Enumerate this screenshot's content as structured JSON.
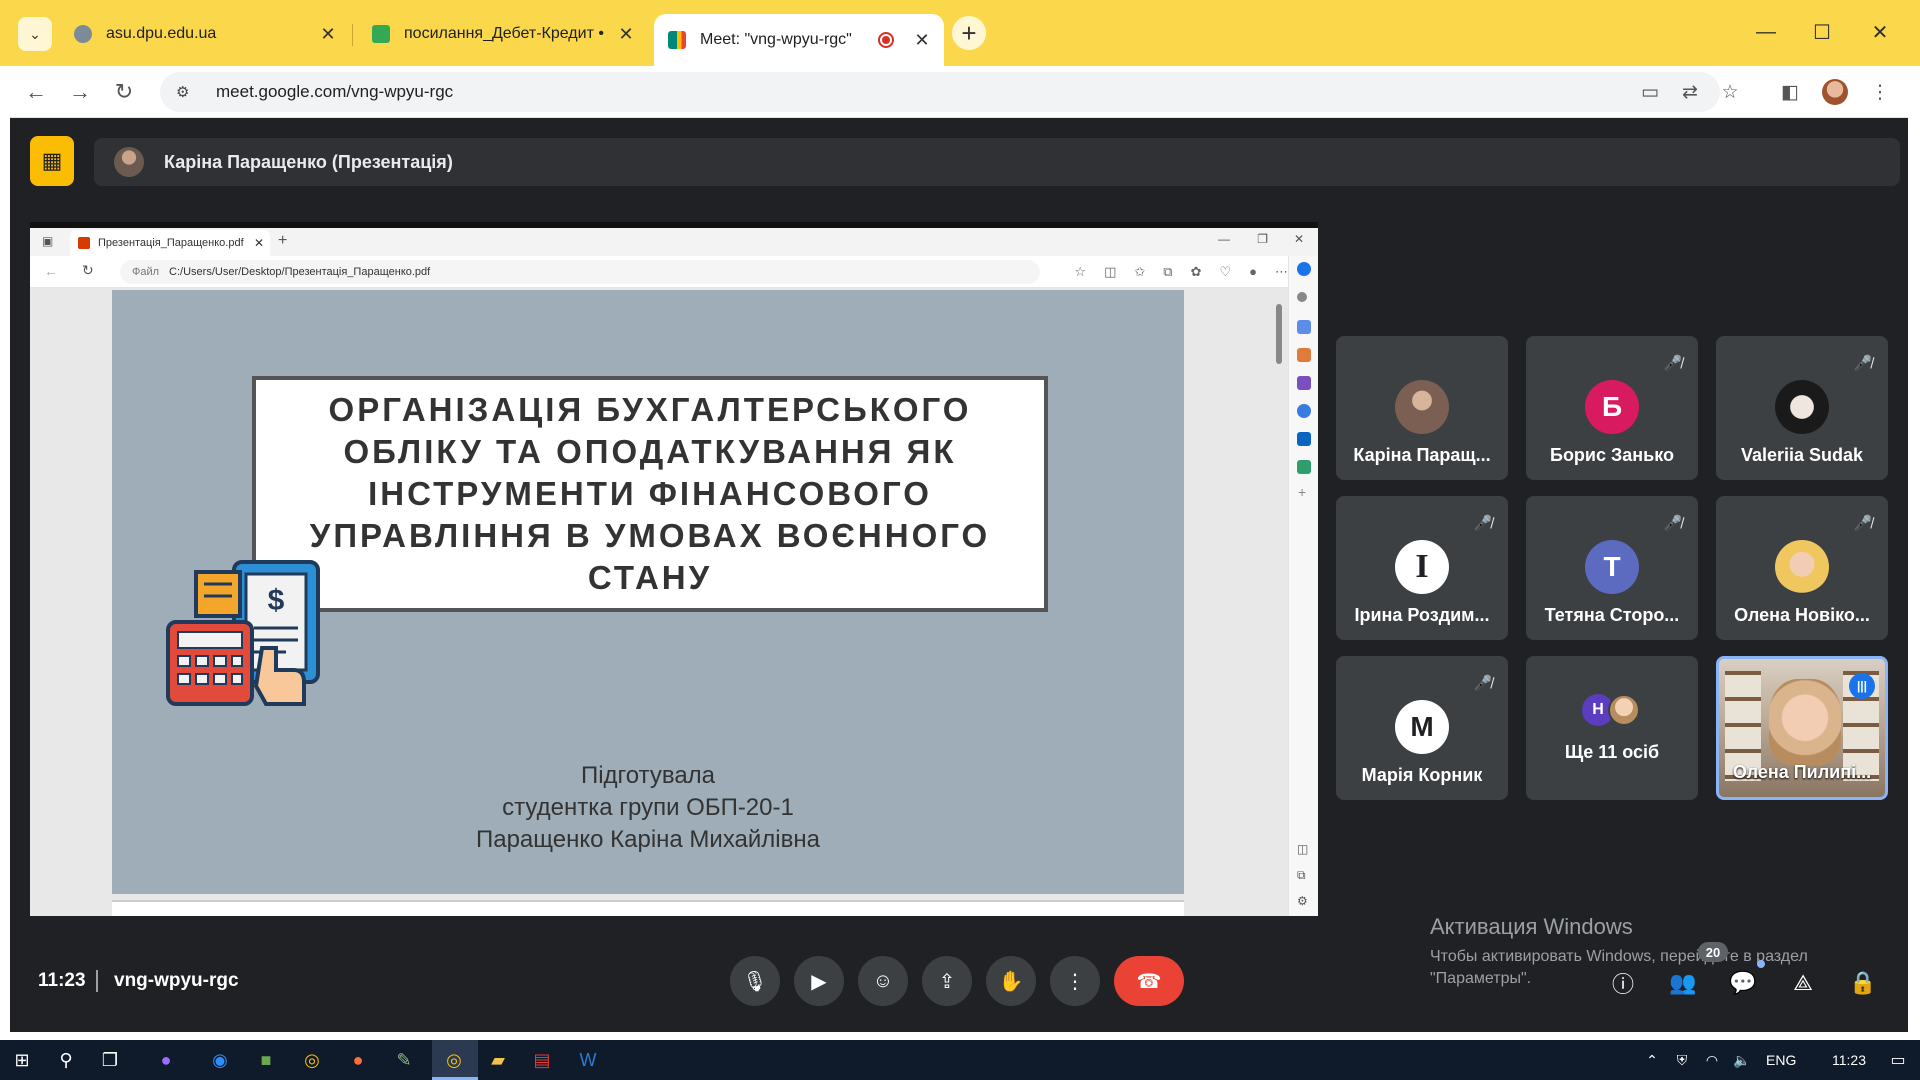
{
  "browser": {
    "tabs": [
      {
        "title": "asu.dpu.edu.ua",
        "favicon_color": "#7d8b99"
      },
      {
        "title": "посилання_Дебет-Кредит • ko",
        "favicon_color": "#34a853"
      },
      {
        "title": "Meet: \"vng-wpyu-rgc\"",
        "favicon_color": "#00897b"
      }
    ],
    "url": "meet.google.com/vng-wpyu-rgc"
  },
  "meet": {
    "presenter_banner": "Каріна Паращенко (Презентація)",
    "clock": "11:23",
    "meeting_code": "vng-wpyu-rgc",
    "people_count": "20",
    "participants": [
      {
        "name": "Каріна Паращ...",
        "avatar_letter": "",
        "avatar_color": "#8d6e63",
        "muted": false
      },
      {
        "name": "Борис Занько",
        "avatar_letter": "Б",
        "avatar_color": "#d81b60",
        "muted": true
      },
      {
        "name": "Valeriia Sudak",
        "avatar_letter": "",
        "avatar_color": "#e0e0e0",
        "muted": true
      },
      {
        "name": "Ірина Роздим...",
        "avatar_letter": "I",
        "avatar_color": "#ffffff",
        "muted": true
      },
      {
        "name": "Тетяна Сторо...",
        "avatar_letter": "T",
        "avatar_color": "#5c6bc0",
        "muted": true
      },
      {
        "name": "Олена Новіко...",
        "avatar_letter": "",
        "avatar_color": "#f0c75e",
        "muted": true
      },
      {
        "name": "Марія Корник",
        "avatar_letter": "M",
        "avatar_color": "#ffffff",
        "muted": true
      },
      {
        "name": "Олена Пилипі...",
        "avatar_letter": "",
        "avatar_color": "#d9b48c",
        "muted": false
      }
    ],
    "more": {
      "label": "Ще 11 осіб",
      "letter": "Н"
    }
  },
  "shared_screen": {
    "tab_title": "Презентація_Паращенко.pdf",
    "address_label": "Файл",
    "address_path": "C:/Users/User/Desktop/Презентація_Паращенко.pdf",
    "slide": {
      "title": "ОРГАНІЗАЦІЯ БУХГАЛТЕРСЬКОГО ОБЛІКУ ТА ОПОДАТКУВАННЯ ЯК ІНСТРУМЕНТИ ФІНАНСОВОГО УПРАВЛІННЯ В УМОВАХ ВОЄННОГО СТАНУ",
      "sub_lines": [
        "Підготувала",
        "студентка групи ОБП-20-1",
        "Паращенко Каріна Михайлівна"
      ],
      "background_color": "#9eadb7"
    }
  },
  "windows_activation": {
    "title": "Активация Windows",
    "line1": "Чтобы активировать Windows, перейдите в раздел",
    "line2": "\"Параметры\"."
  },
  "taskbar": {
    "language": "ENG",
    "time": "11:23"
  }
}
